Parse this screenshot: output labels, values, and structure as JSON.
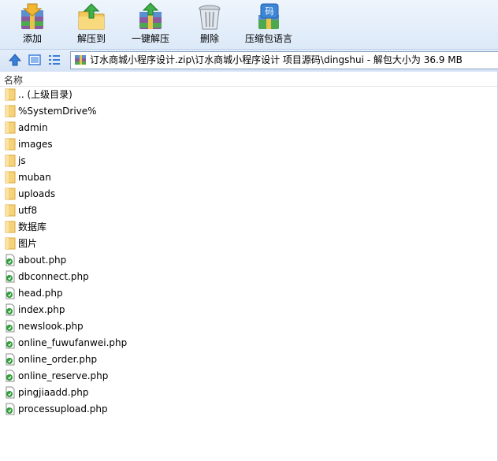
{
  "toolbar": {
    "buttons": [
      {
        "label": "添加",
        "icon": "add-archive-icon"
      },
      {
        "label": "解压到",
        "icon": "extract-to-icon"
      },
      {
        "label": "一键解压",
        "icon": "one-click-extract-icon"
      },
      {
        "label": "删除",
        "icon": "delete-icon"
      },
      {
        "label": "压缩包语言",
        "icon": "archive-language-icon"
      }
    ]
  },
  "nav": {
    "path": "订水商城小程序设计.zip\\订水商城小程序设计 项目源码\\dingshui - 解包大小为 36.9 MB"
  },
  "list": {
    "column_name": "名称",
    "items": [
      {
        "name": ".. (上级目录)",
        "type": "folder"
      },
      {
        "name": "%SystemDrive%",
        "type": "folder"
      },
      {
        "name": "admin",
        "type": "folder"
      },
      {
        "name": "images",
        "type": "folder"
      },
      {
        "name": "js",
        "type": "folder"
      },
      {
        "name": "muban",
        "type": "folder"
      },
      {
        "name": "uploads",
        "type": "folder"
      },
      {
        "name": "utf8",
        "type": "folder"
      },
      {
        "name": "数据库",
        "type": "folder"
      },
      {
        "name": "图片",
        "type": "folder"
      },
      {
        "name": "about.php",
        "type": "php"
      },
      {
        "name": "dbconnect.php",
        "type": "php"
      },
      {
        "name": "head.php",
        "type": "php"
      },
      {
        "name": "index.php",
        "type": "php"
      },
      {
        "name": "newslook.php",
        "type": "php"
      },
      {
        "name": "online_fuwufanwei.php",
        "type": "php"
      },
      {
        "name": "online_order.php",
        "type": "php"
      },
      {
        "name": "online_reserve.php",
        "type": "php"
      },
      {
        "name": "pingjiaadd.php",
        "type": "php"
      },
      {
        "name": "processupload.php",
        "type": "php"
      }
    ]
  },
  "colors": {
    "folder": "#f6d27a",
    "folder_edge": "#d9a93c",
    "php_green": "#2e9e3a",
    "toolbar_bg": "#dce9f8",
    "accent_blue": "#3b7dd8"
  }
}
